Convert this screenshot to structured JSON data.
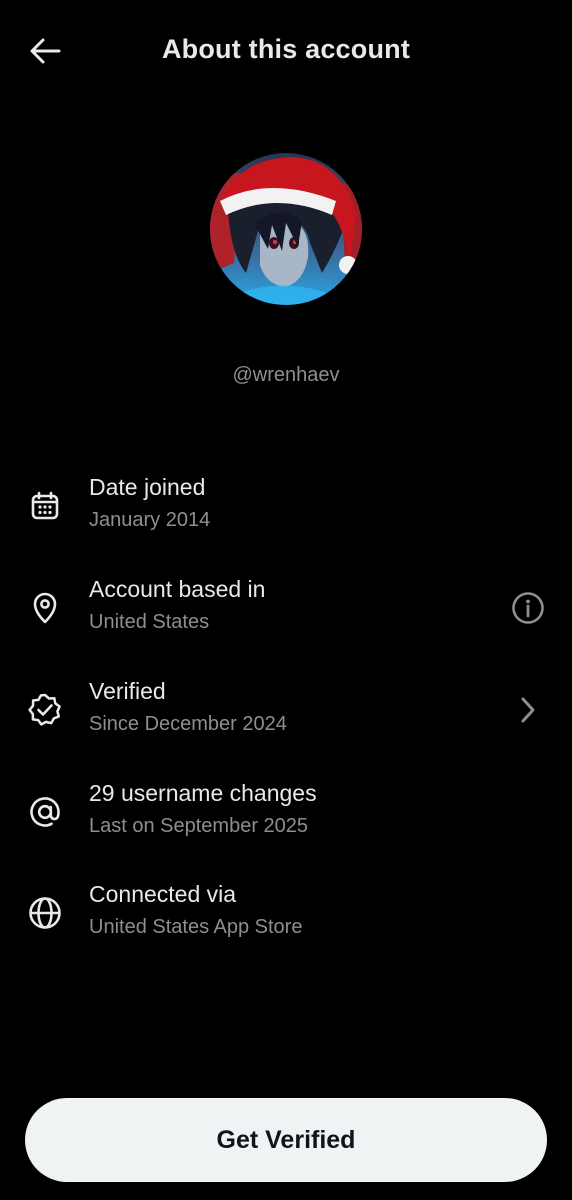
{
  "header": {
    "title": "About this account",
    "back_icon": "arrow-left-icon"
  },
  "profile": {
    "avatar_icon": "profile-avatar",
    "handle": "@wrenhaev"
  },
  "details": [
    {
      "label": "Date joined",
      "value": "January 2014",
      "icon": "calendar-icon"
    },
    {
      "label": "Account based in",
      "value": "United States",
      "icon": "location-pin-icon",
      "trailing": "info-icon"
    },
    {
      "label": "Verified",
      "value": "Since December 2024",
      "icon": "verified-badge-icon",
      "trailing": "chevron-right-icon"
    },
    {
      "label": "29 username changes",
      "value": "Last on September 2025",
      "icon": "at-sign-icon"
    },
    {
      "label": "Connected via",
      "value": "United States App Store",
      "icon": "globe-icon"
    }
  ],
  "cta": {
    "label": "Get Verified"
  },
  "colors": {
    "background": "#000000",
    "primary_text": "#e7e9ea",
    "secondary_text": "#8b8f93",
    "button_bg": "#eff3f4",
    "button_text": "#0f1419"
  }
}
